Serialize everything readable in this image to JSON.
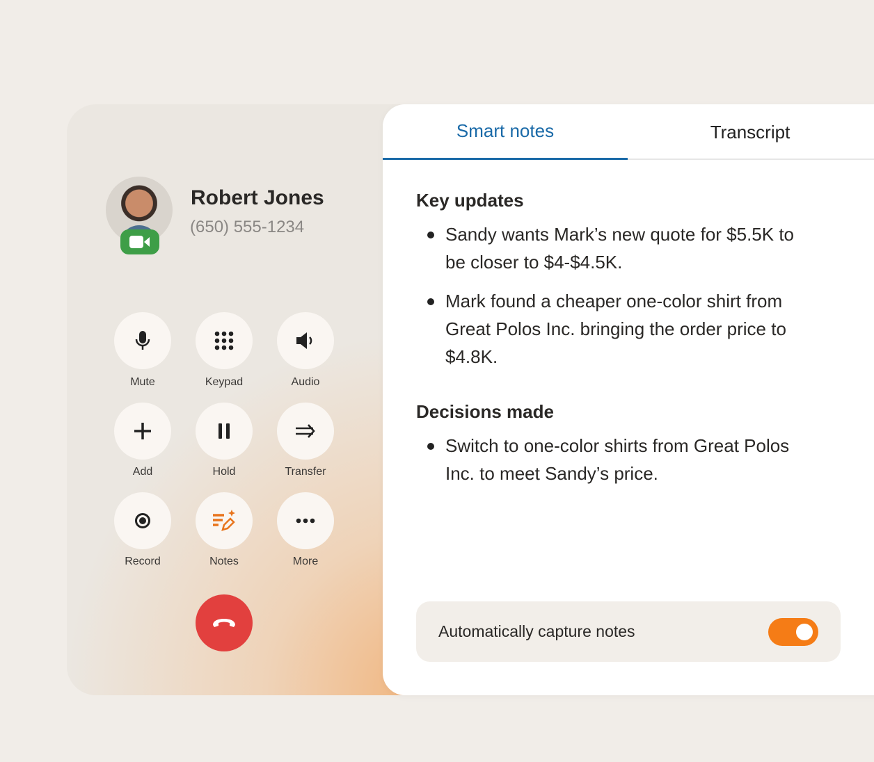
{
  "contact": {
    "name": "Robert Jones",
    "phone": "(650) 555-1234"
  },
  "controls": [
    {
      "label": "Mute",
      "icon": "microphone-icon"
    },
    {
      "label": "Keypad",
      "icon": "keypad-icon"
    },
    {
      "label": "Audio",
      "icon": "speaker-icon"
    },
    {
      "label": "Add",
      "icon": "plus-icon"
    },
    {
      "label": "Hold",
      "icon": "pause-icon"
    },
    {
      "label": "Transfer",
      "icon": "transfer-icon"
    },
    {
      "label": "Record",
      "icon": "record-icon"
    },
    {
      "label": "Notes",
      "icon": "smart-notes-icon"
    },
    {
      "label": "More",
      "icon": "more-icon"
    }
  ],
  "tabs": [
    {
      "label": "Smart notes",
      "active": true
    },
    {
      "label": "Transcript",
      "active": false
    }
  ],
  "notes": {
    "key_updates": {
      "heading": "Key updates",
      "items": [
        "Sandy wants Mark’s new quote for $5.5K to be closer to $4-$4.5K.",
        "Mark found a cheaper one-color shirt from Great Polos Inc. bringing the order price to $4.8K."
      ]
    },
    "decisions": {
      "heading": "Decisions made",
      "items": [
        "Switch to one-color shirts from Great Polos Inc. to meet Sandy’s price."
      ]
    }
  },
  "auto_capture": {
    "label": "Automatically capture notes",
    "enabled": true
  },
  "colors": {
    "accent": "#1a6aa8",
    "toggle": "#f57c16",
    "end_call": "#e2403e",
    "video_badge": "#3e9e47"
  }
}
